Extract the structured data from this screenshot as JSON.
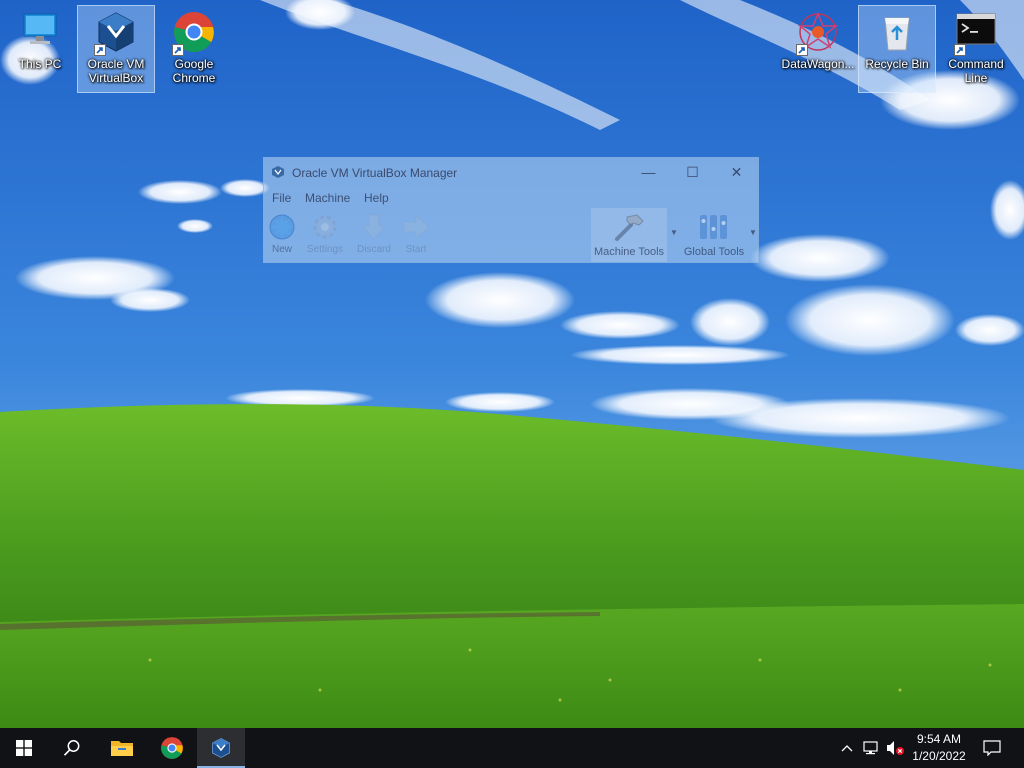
{
  "desktop": {
    "icons": [
      {
        "name": "This PC",
        "label": "This PC"
      },
      {
        "name": "Oracle VM VirtualBox",
        "label": "Oracle VM\nVirtualBox"
      },
      {
        "name": "Google Chrome",
        "label": "Google\nChrome"
      },
      {
        "name": "DataWagon",
        "label": "DataWagon..."
      },
      {
        "name": "Recycle Bin",
        "label": "Recycle Bin"
      },
      {
        "name": "Command Line",
        "label": "Command\nLine"
      }
    ]
  },
  "vbox_window": {
    "title": "Oracle VM VirtualBox Manager",
    "menu": [
      "File",
      "Machine",
      "Help"
    ],
    "toolbar": {
      "new": "New",
      "settings": "Settings",
      "discard": "Discard",
      "start": "Start",
      "machine_tools": "Machine Tools",
      "global_tools": "Global Tools"
    },
    "controls": {
      "minimize": "—",
      "maximize": "☐",
      "close": "✕"
    }
  },
  "taskbar": {
    "apps": [
      "Start",
      "Search",
      "File Explorer",
      "Google Chrome",
      "Oracle VM VirtualBox"
    ],
    "active_app": "Oracle VM VirtualBox",
    "clock_time": "9:54 AM",
    "clock_date": "1/20/2022"
  },
  "colors": {
    "taskbar": "#101216",
    "sky": "#2f7ad6",
    "grass": "#4a9a1e",
    "accent": "#8ab4e8"
  }
}
